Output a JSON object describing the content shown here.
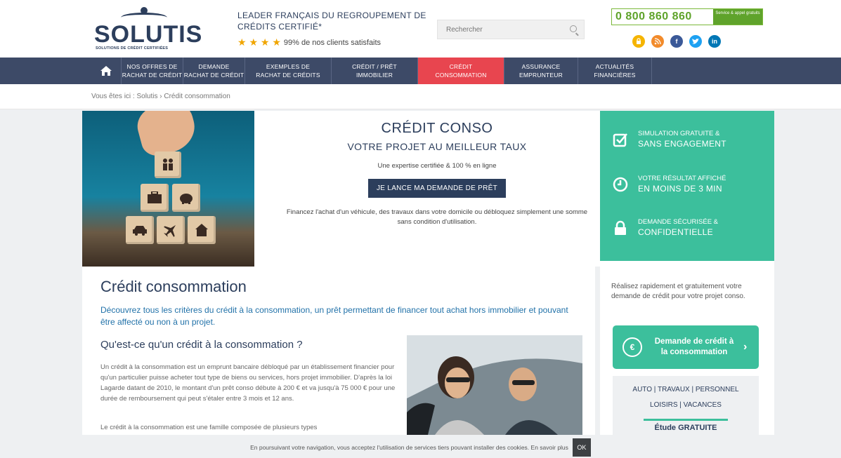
{
  "header": {
    "logo_text": "SOLUTIS",
    "logo_sub": "SOLUTIONS DE CRÉDIT CERTIFIÉES",
    "tagline": "LEADER FRANÇAIS DU REGROUPEMENT DE CRÉDITS CERTIFIÉ*",
    "rating_text": "99% de nos clients satisfaits",
    "stars": "★ ★ ★ ★",
    "search_placeholder": "Rechercher",
    "phone": "0 800 860 860",
    "phone_tag": "Service & appel gratuits",
    "social_icons": [
      "lock-icon",
      "rss-icon",
      "facebook-icon",
      "twitter-icon",
      "linkedin-icon"
    ],
    "social_glyphs": [
      "🔒",
      " ",
      "f",
      "t",
      "in"
    ]
  },
  "nav": {
    "home_icon": "home-icon",
    "items": [
      "NOS OFFRES DE\nRACHAT DE CRÉDIT",
      "DEMANDE\nRACHAT DE CRÉDIT",
      "EXEMPLES DE\nRACHAT DE CRÉDITS",
      "CRÉDIT / PRÊT\nIMMOBILIER",
      "CRÉDIT\nCONSOMMATION",
      "ASSURANCE\nEMPRUNTEUR",
      "ACTUALITÉS\nFINANCIÈRES"
    ]
  },
  "breadcrumb": "Vous êtes ici : Solutis › Crédit consommation",
  "hero": {
    "title": "CRÉDIT CONSO",
    "subtitle": "VOTRE PROJET AU MEILLEUR TAUX",
    "expertise": "Une expertise certifiée & 100 % en ligne",
    "cta": "JE LANCE MA DEMANDE DE PRÊT",
    "description": "Financez l'achat d'un véhicule, des travaux dans votre domicile ou débloquez simplement une somme sans condition d'utilisation.",
    "features": [
      {
        "line1": "SIMULATION GRATUITE &",
        "line2": "SANS ENGAGEMENT"
      },
      {
        "line1": "VOTRE RÉSULTAT AFFICHÉ",
        "line2": "EN MOINS DE 3 MIN"
      },
      {
        "line1": "DEMANDE SÉCURISÉE &",
        "line2": "CONFIDENTIELLE"
      }
    ]
  },
  "main": {
    "title": "Crédit consommation",
    "intro": "Découvrez tous les critères du crédit à la consommation, un prêt permettant de financer tout achat hors immobilier et pouvant être affecté ou non à un projet.",
    "h2": "Qu'est-ce qu'un crédit à la consommation ?",
    "p1": "Un crédit à la consommation est un emprunt bancaire débloqué par un établissement financier pour qu'un particulier puisse acheter tout type de biens ou services, hors projet immobilier. D'après la loi Lagarde datant de 2010, le montant d'un prêt conso débute à 200 € et va jusqu'à 75 000 € pour une durée de remboursement qui peut s'étaler entre 3 mois et 12 ans.",
    "p2": "Le crédit à la consommation est une famille composée de plusieurs types"
  },
  "sidebar": {
    "text": "Réalisez rapidement et gratuitement votre demande de crédit pour votre projet conso.",
    "button": "Demande de crédit à la consommation",
    "cats_line1": "AUTO | TRAVAUX | PERSONNEL",
    "cats_line2": "LOISIRS | VACANCES",
    "cats_bold": "Étude GRATUITE"
  },
  "cookie": {
    "text": "En poursuivant votre navigation, vous acceptez l'utilisation de services tiers pouvant installer des cookies. En savoir plus",
    "ok": "OK"
  },
  "colors": {
    "navy": "#2c3e5c",
    "nav_bg": "#3d4a67",
    "active": "#e8454f",
    "teal": "#3cbf9c",
    "green": "#5fa32b"
  }
}
